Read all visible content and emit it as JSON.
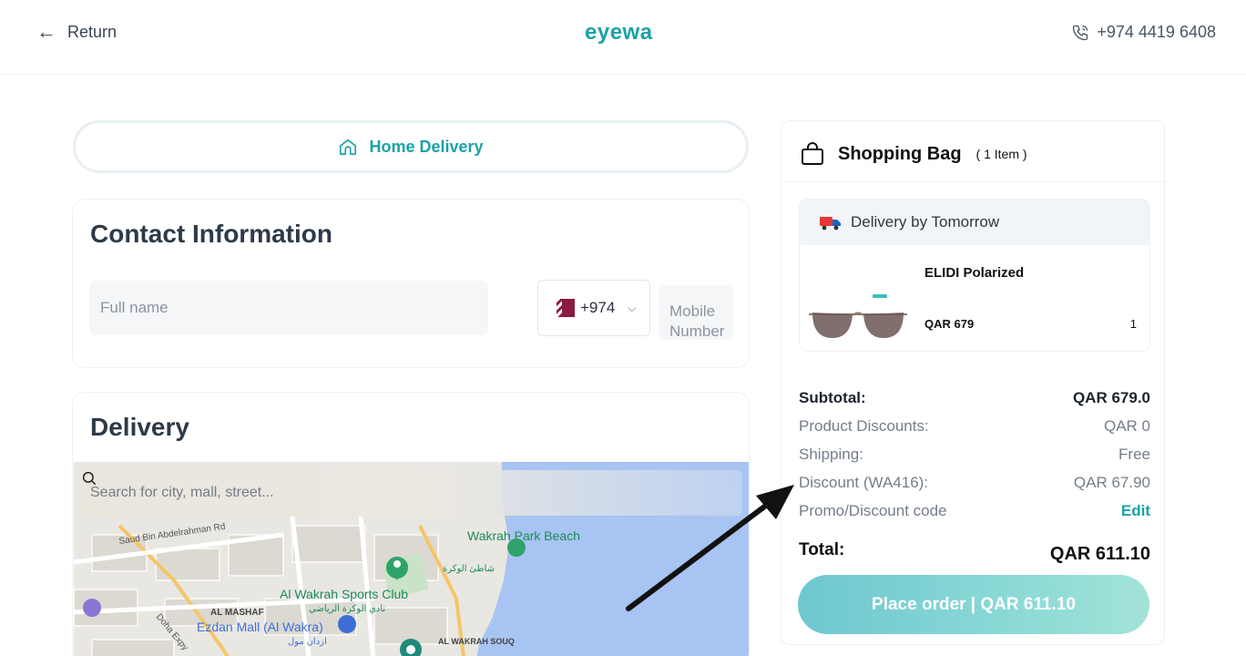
{
  "header": {
    "return_label": "Return",
    "logo": "eyewa",
    "phone": "+974 4419 6408"
  },
  "delivery_tab": {
    "label": "Home Delivery"
  },
  "contact": {
    "title": "Contact Information",
    "fullname_placeholder": "Full name",
    "country_code": "+974",
    "mobile_placeholder": "Mobile Number"
  },
  "delivery": {
    "title": "Delivery",
    "search_placeholder": "Search for city, mall, street...",
    "map_labels": {
      "road1": "Saud Bin Abdelrahman Rd",
      "beach_en": "Wakrah Park Beach",
      "beach_ar": "شاطئ الوكرة",
      "club_en": "Al Wakrah Sports Club",
      "club_ar": "نادي الوكرة الرياضي",
      "mashaf": "AL MASHAF",
      "mall_en": "Ezdan Mall (Al Wakra)",
      "mall_ar": "ازدان مول",
      "souq": "AL WAKRAH SOUQ",
      "expressway": "Doha Expy"
    }
  },
  "bag": {
    "title": "Shopping Bag",
    "count": "( 1 Item )",
    "delivery_banner": "Delivery by Tomorrow",
    "product": {
      "name": "ELIDI Polarized",
      "price": "QAR 679",
      "qty": "1"
    },
    "summary": {
      "subtotal_label": "Subtotal:",
      "subtotal_value": "QAR 679.0",
      "product_discounts_label": "Product Discounts:",
      "product_discounts_value": "QAR 0",
      "shipping_label": "Shipping:",
      "shipping_value": "Free",
      "discount_label": "Discount (WA416):",
      "discount_value": "QAR 67.90",
      "promo_label": "Promo/Discount code",
      "promo_action": "Edit",
      "total_label": "Total:",
      "total_value": "QAR 611.10"
    },
    "place_order": "Place order | QAR 611.10"
  },
  "colors": {
    "brand": "#1aa2a8",
    "button_start": "#6ec7cf",
    "button_end": "#a3e3d8"
  }
}
